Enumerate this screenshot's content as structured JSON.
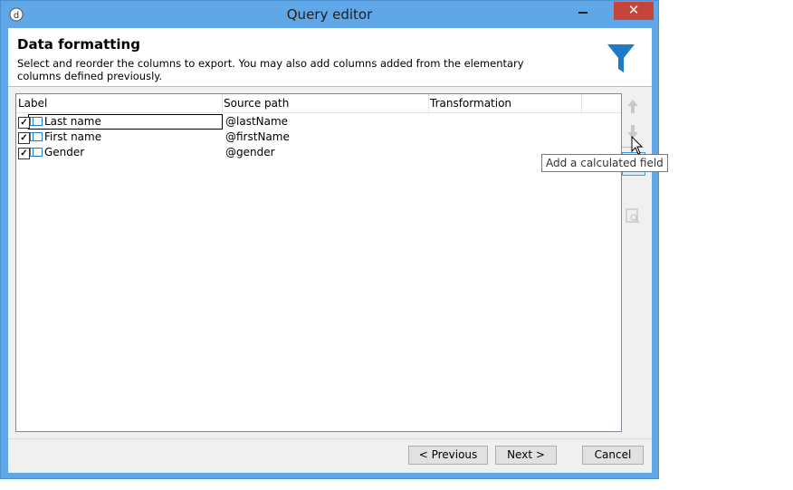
{
  "window": {
    "title": "Query editor",
    "close_glyph": "✕"
  },
  "header": {
    "title": "Data formatting",
    "description": "Select and reorder the columns to export. You may also add columns added from the elementary columns defined previously.",
    "icon": "filter-funnel-icon"
  },
  "grid": {
    "columns": [
      "Label",
      "Source path",
      "Transformation"
    ],
    "rows": [
      {
        "checked": true,
        "label": "Last name",
        "source": "@lastName",
        "transformation": ""
      },
      {
        "checked": true,
        "label": "First name",
        "source": "@firstName",
        "transformation": ""
      },
      {
        "checked": true,
        "label": "Gender",
        "source": "@gender",
        "transformation": ""
      }
    ]
  },
  "side_toolbar": {
    "move_up": "arrow-up-icon",
    "move_down": "arrow-down-icon",
    "add_calculated": "calculated-field-icon",
    "preview": "preview-icon",
    "tooltip": "Add a calculated field"
  },
  "footer": {
    "previous_label": "< Previous",
    "next_label": "Next >",
    "cancel_label": "Cancel"
  },
  "colors": {
    "title_bar": "#5fa7e6",
    "close": "#c7443a",
    "accent_blue": "#1e7bc8"
  }
}
